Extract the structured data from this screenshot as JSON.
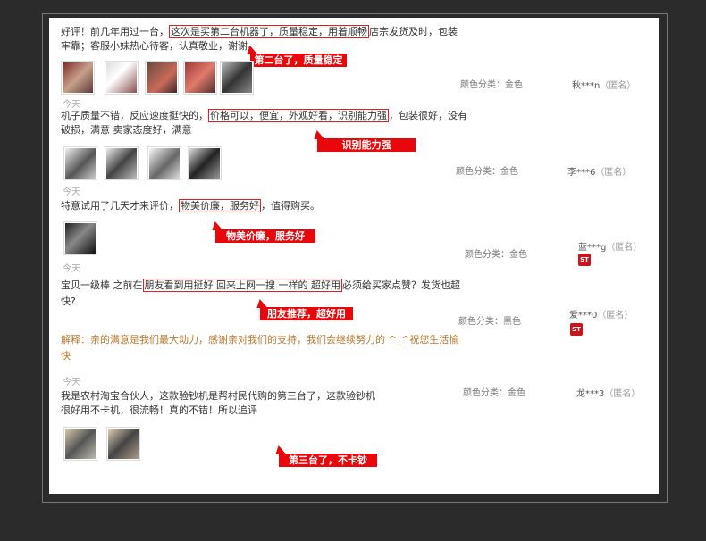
{
  "reviews": [
    {
      "line1_pre": "好评！前几年用过一台，",
      "line1_hl": "这次是买第二台机器了，质量稳定，用着顺畅",
      "line1_post": "店宗发货及时，包装",
      "line2": "牢靠；客服小妹热心待客，认真敬业，谢谢。",
      "callout": "第二台了，质量稳定",
      "date": "今天",
      "spec": "颜色分类：金色",
      "user": "秋***n",
      "anon": "（匿名）"
    },
    {
      "line1_pre": "机子质量不错，反应速度挺快的，",
      "line1_hl": "价格可以，便宜，外观好看，识别能力强",
      "line1_post": "，包装很好，没有",
      "line2": "破损，满意 卖家态度好，满意",
      "callout": "识别能力强",
      "date": "今天",
      "spec": "颜色分类：金色",
      "user": "李***6",
      "anon": "（匿名）"
    },
    {
      "line1_pre": "特意试用了几天才来评价，",
      "line1_hl": "物美价廉，服务好",
      "line1_post": "，值得购买。",
      "callout": "物美价廉，服务好",
      "date": "今天",
      "spec": "颜色分类：金色",
      "user": "蓝***g",
      "anon": "（匿名）"
    },
    {
      "line1_pre": "宝贝一级棒 之前在",
      "line1_hl": "朋友看到用挺好 回来上网一搜 一样的 超好用",
      "line1_post": "必须给买家点赞？发货也超",
      "line2": "快?",
      "callout": "朋友推荐，超好用",
      "reply_line1": "解释：亲的满意是我们最大动力，感谢亲对我们的支持，我们会继续努力的 ^_^祝您生活愉",
      "reply_line2": "快",
      "date": "今天",
      "spec": "颜色分类：黑色",
      "user": "爱***0",
      "anon": "（匿名）"
    },
    {
      "line1": "我是农村淘宝合伙人，这款验钞机是帮村民代购的第三台了，这款验钞机",
      "line2": "很好用不卡机，很流畅！真的不错！所以追评",
      "callout": "第三台了，不卡钞",
      "spec": "颜色分类：金色",
      "user": "龙***3",
      "anon": "（匿名）"
    }
  ],
  "badge_label": "ST",
  "colors": {
    "accent": "#e8070a",
    "reply": "#b8782e"
  }
}
